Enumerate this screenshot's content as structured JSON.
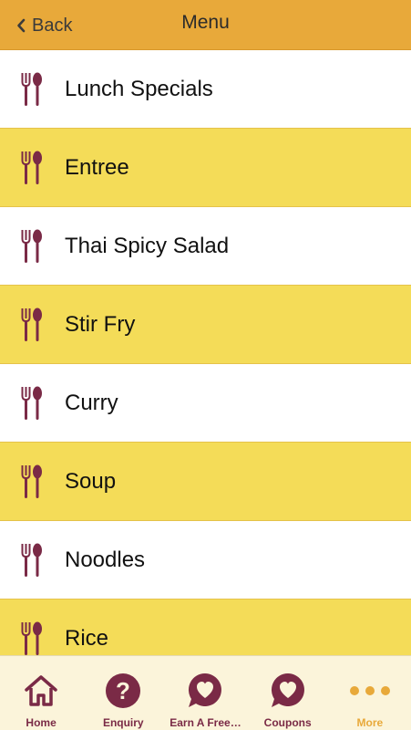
{
  "header": {
    "back_label": "Back",
    "title": "Menu"
  },
  "menu": {
    "icon": "fork-spoon-icon",
    "items": [
      {
        "label": "Lunch Specials",
        "style": "white"
      },
      {
        "label": "Entree",
        "style": "yellow"
      },
      {
        "label": "Thai Spicy Salad",
        "style": "white"
      },
      {
        "label": "Stir Fry",
        "style": "yellow"
      },
      {
        "label": "Curry",
        "style": "white"
      },
      {
        "label": "Soup",
        "style": "yellow"
      },
      {
        "label": "Noodles",
        "style": "white"
      },
      {
        "label": "Rice",
        "style": "yellow"
      }
    ]
  },
  "tabbar": {
    "tabs": [
      {
        "label": "Home",
        "icon": "home-icon",
        "active": false
      },
      {
        "label": "Enquiry",
        "icon": "question-icon",
        "active": false
      },
      {
        "label": "Earn A Free…",
        "icon": "heart-bubble-icon",
        "active": false
      },
      {
        "label": "Coupons",
        "icon": "heart-bubble-icon",
        "active": false
      },
      {
        "label": "More",
        "icon": "more-dots-icon",
        "active": true
      }
    ]
  },
  "colors": {
    "header_bg": "#E8A93A",
    "row_yellow": "#F4DC58",
    "icon_maroon": "#7A2A46",
    "active_tab": "#E8A93A"
  }
}
